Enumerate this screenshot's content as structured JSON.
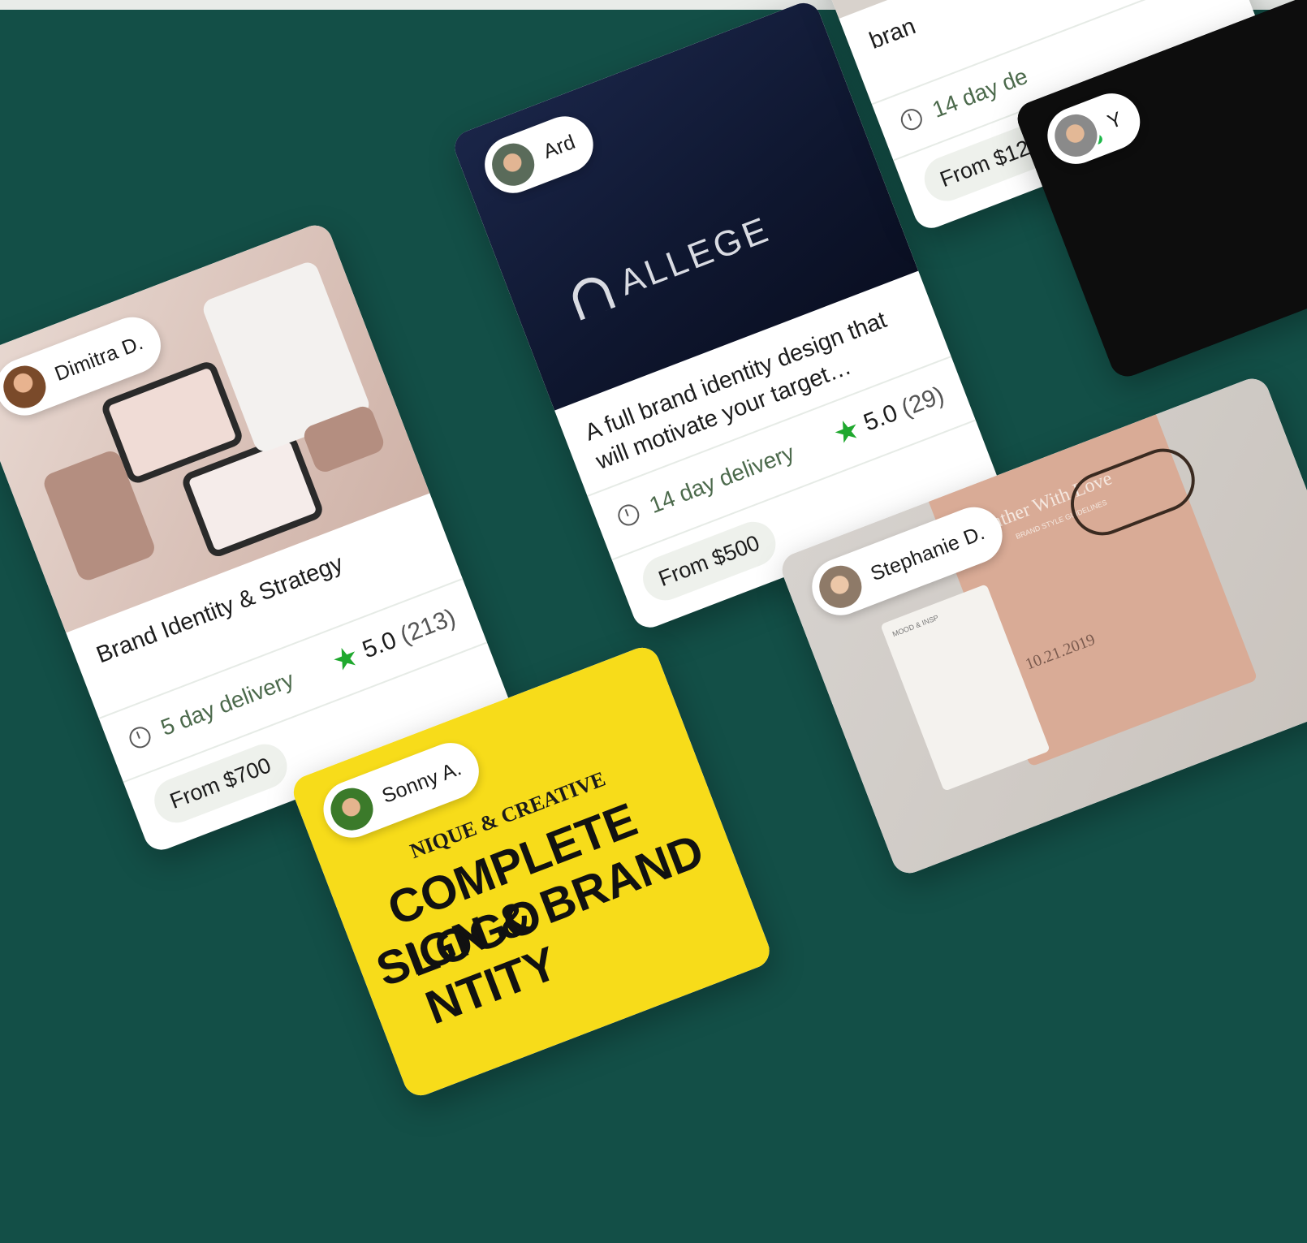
{
  "cards": [
    {
      "seller": "Dimitra D.",
      "title": "Brand Identity & Strategy",
      "delivery": "5 day delivery",
      "rating": "5.0",
      "reviews": "(213)",
      "price": "From $700"
    },
    {
      "seller": "Ard",
      "brand": "ALLEGE",
      "title": "A full brand identity design that will motivate your target…",
      "delivery": "14 day delivery",
      "rating": "5.0",
      "reviews": "(29)",
      "price": "From $500"
    },
    {
      "title": "bran",
      "delivery": "14 day de",
      "price": "From $12"
    },
    {
      "seller": "Sonny A.",
      "tagline": "NIQUE & CREATIVE",
      "headline1": "COMPLETE LOGO",
      "headline2": "SIGN & BRAND",
      "headline3": "NTITY"
    },
    {
      "seller": "Stephanie D.",
      "booklet_title": "Lather With Love",
      "booklet_sub": "BRAND STYLE GUIDELINES",
      "booklet_date": "10.21.2019",
      "side_card": "MOOD & INSP"
    },
    {
      "seller": "Y"
    }
  ],
  "icons": {
    "clock": "clock-icon",
    "star": "star-icon"
  },
  "colors": {
    "background": "#134f47",
    "star": "#1fa82e",
    "delivery_text": "#4c6a4c",
    "yellow_card": "#f7dc1a",
    "navy_card": "#111a36"
  }
}
